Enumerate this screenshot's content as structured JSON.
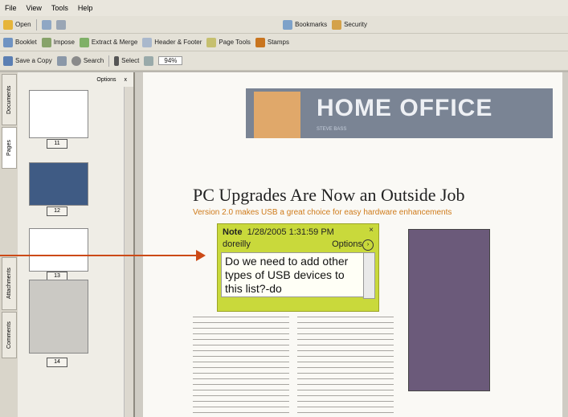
{
  "menu": [
    "File",
    "View",
    "Tools",
    "Help"
  ],
  "toolbar1": {
    "open": "Open",
    "bookmarks": "Bookmarks",
    "security": "Security"
  },
  "toolbar2": {
    "booklet": "Booklet",
    "impose": "Impose",
    "extract": "Extract & Merge",
    "header_footer": "Header & Footer",
    "page_tools": "Page Tools",
    "stamps": "Stamps"
  },
  "toolbar3": {
    "save_copy": "Save a Copy",
    "search": "Search",
    "select": "Select",
    "zoom": "94%"
  },
  "left_tabs": [
    "Documents",
    "Pages",
    "Attachments",
    "Comments"
  ],
  "pages_panel": {
    "options": "Options",
    "close": "x",
    "thumbs": [
      "11",
      "12",
      "13",
      "14"
    ]
  },
  "page": {
    "banner_title": "HOME OFFICE",
    "banner_sub": "STEVE BASS",
    "headline": "PC Upgrades Are Now an Outside Job",
    "subhead": "Version 2.0 makes USB a great choice for easy hardware enhancements"
  },
  "note": {
    "title": "Note",
    "date": "1/28/2005 1:31:59 PM",
    "author": "doreilly",
    "options": "Options",
    "body": "Do we need to add other types of USB devices to this list?-do"
  },
  "colors": {
    "accent_arrow": "#cc4a17",
    "note_yellow": "#c9d93b",
    "subhead_orange": "#cf7b1b"
  }
}
